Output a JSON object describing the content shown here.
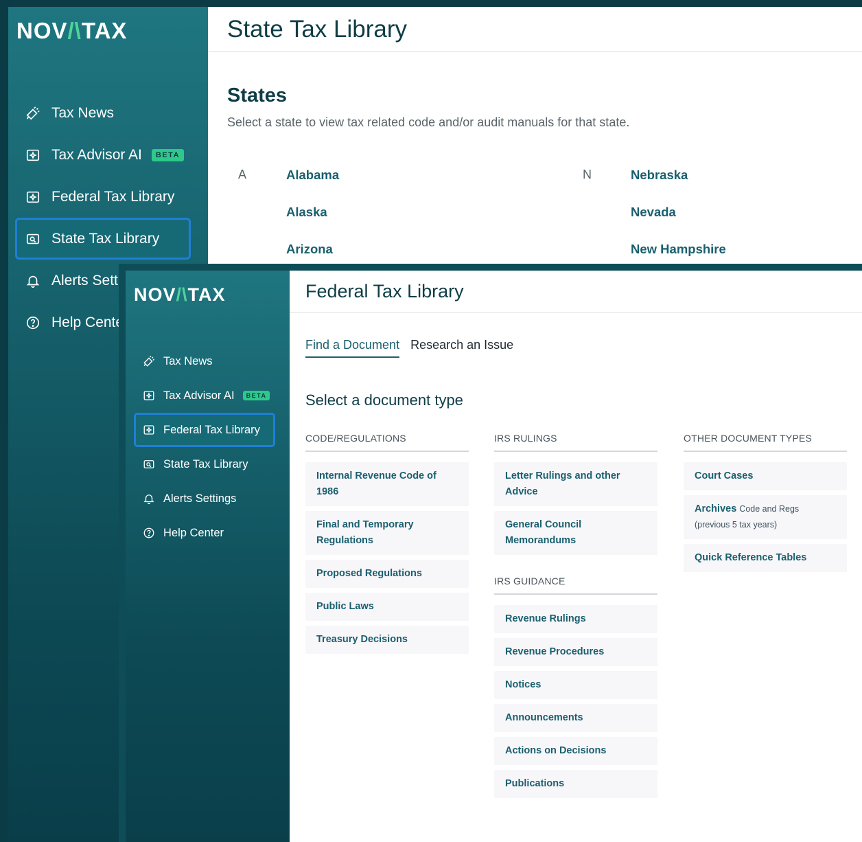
{
  "brand": {
    "logo_left": "NOV",
    "logo_mid": "/\\",
    "logo_right": "TAX"
  },
  "nav": {
    "tax_news": "Tax News",
    "tax_advisor": "Tax Advisor AI",
    "beta": "BETA",
    "federal": "Federal Tax Library",
    "state": "State Tax Library",
    "alerts": "Alerts Settings",
    "help": "Help Center"
  },
  "back_window": {
    "title": "State Tax Library",
    "active_nav": "state",
    "alerts_visible": "Alerts Setti",
    "help_visible": "Help Cente",
    "section_title": "States",
    "section_desc": "Select a state to view tax related code and/or audit manuals for that state.",
    "groups": [
      {
        "letter": "A",
        "states": [
          "Alabama",
          "Alaska",
          "Arizona"
        ]
      },
      {
        "letter": "N",
        "states": [
          "Nebraska",
          "Nevada",
          "New Hampshire"
        ]
      }
    ]
  },
  "front_window": {
    "title": "Federal Tax Library",
    "active_nav": "federal",
    "tabs": [
      {
        "label": "Find a Document",
        "active": true
      },
      {
        "label": "Research an Issue",
        "active": false
      }
    ],
    "doc_heading": "Select a document type",
    "columns": {
      "code": {
        "heading": "CODE/REGULATIONS",
        "items": [
          "Internal Revenue Code of 1986",
          "Final and Temporary Regulations",
          "Proposed Regulations",
          "Public Laws",
          "Treasury Decisions"
        ]
      },
      "irs_rulings": {
        "heading": "IRS RULINGS",
        "items": [
          "Letter Rulings and other Advice",
          "General Council Memorandums"
        ]
      },
      "irs_guidance": {
        "heading": "IRS GUIDANCE",
        "items": [
          "Revenue Rulings",
          "Revenue Procedures",
          "Notices",
          "Announcements",
          "Actions on Decisions",
          "Publications"
        ]
      },
      "other": {
        "heading": "OTHER DOCUMENT TYPES",
        "court": "Court Cases",
        "archives_main": "Archives",
        "archives_rest": "Code and Regs",
        "archives_sub": "(previous 5 tax years)",
        "quick": "Quick Reference Tables"
      }
    }
  },
  "colors": {
    "brand_teal": "#1f6f78",
    "accent_green": "#2ec98a",
    "link": "#1a5f6e",
    "active_border": "#1f7fd6"
  }
}
